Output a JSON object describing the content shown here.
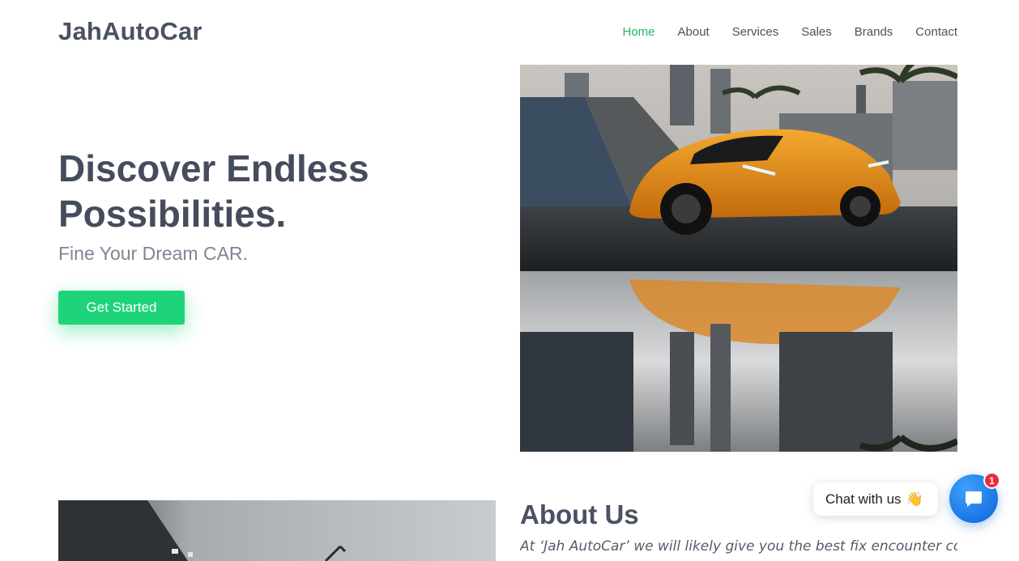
{
  "header": {
    "logo": "JahAutoCar",
    "nav": [
      {
        "label": "Home",
        "active": true
      },
      {
        "label": "About",
        "active": false
      },
      {
        "label": "Services",
        "active": false
      },
      {
        "label": "Sales",
        "active": false
      },
      {
        "label": "Brands",
        "active": false
      },
      {
        "label": "Contact",
        "active": false
      }
    ]
  },
  "hero": {
    "title_line1": "Discover Endless",
    "title_line2": "Possibilities.",
    "subtitle": "Fine Your Dream CAR.",
    "cta_label": "Get Started"
  },
  "about": {
    "title": "About Us",
    "text": "At ‘Jah AutoCar’ we will likely give you the best fix encounter conceivable and"
  },
  "chat": {
    "label": "Chat with us",
    "wave": "👋",
    "badge_count": "1"
  },
  "colors": {
    "accent": "#1ed47a",
    "nav_active": "#1fb566",
    "chat_blue": "#0a63d9",
    "badge_red": "#ee2b3b"
  }
}
